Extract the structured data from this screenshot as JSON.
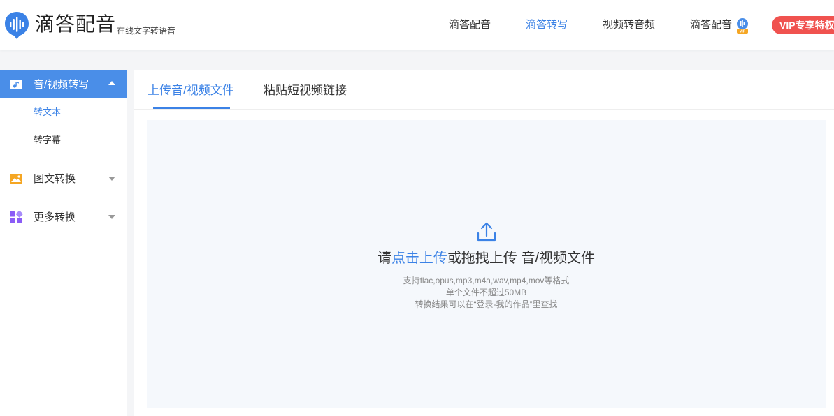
{
  "brand": {
    "title": "滴答配音",
    "subtitle": "在线文字转语音",
    "color": "#3b82e6"
  },
  "nav": {
    "items": [
      {
        "label": "滴答配音",
        "active": false
      },
      {
        "label": "滴答转写",
        "active": true
      },
      {
        "label": "视频转音频",
        "active": false
      },
      {
        "label": "滴答配音",
        "active": false
      }
    ],
    "vip_button": "VIP专享特权",
    "vip_color": "#f0524f"
  },
  "sidebar": {
    "sections": [
      {
        "label": "音/视频转写",
        "icon": "music-video-icon",
        "expanded": true,
        "items": [
          {
            "label": "转文本",
            "active": true
          },
          {
            "label": "转字幕",
            "active": false
          }
        ]
      },
      {
        "label": "图文转换",
        "icon": "image-icon",
        "expanded": false
      },
      {
        "label": "更多转换",
        "icon": "apps-icon",
        "expanded": false
      }
    ]
  },
  "main": {
    "tabs": [
      {
        "label": "上传音/视频文件",
        "active": true
      },
      {
        "label": "粘贴短视频链接",
        "active": false
      }
    ],
    "upload": {
      "title_prefix": "请",
      "title_link": "点击上传",
      "title_suffix": "或拖拽上传 音/视频文件",
      "hints": [
        "支持flac,opus,mp3,m4a,wav,mp4,mov等格式",
        "单个文件不超过50MB",
        "转换结果可以在“登录-我的作品”里查找"
      ]
    }
  }
}
